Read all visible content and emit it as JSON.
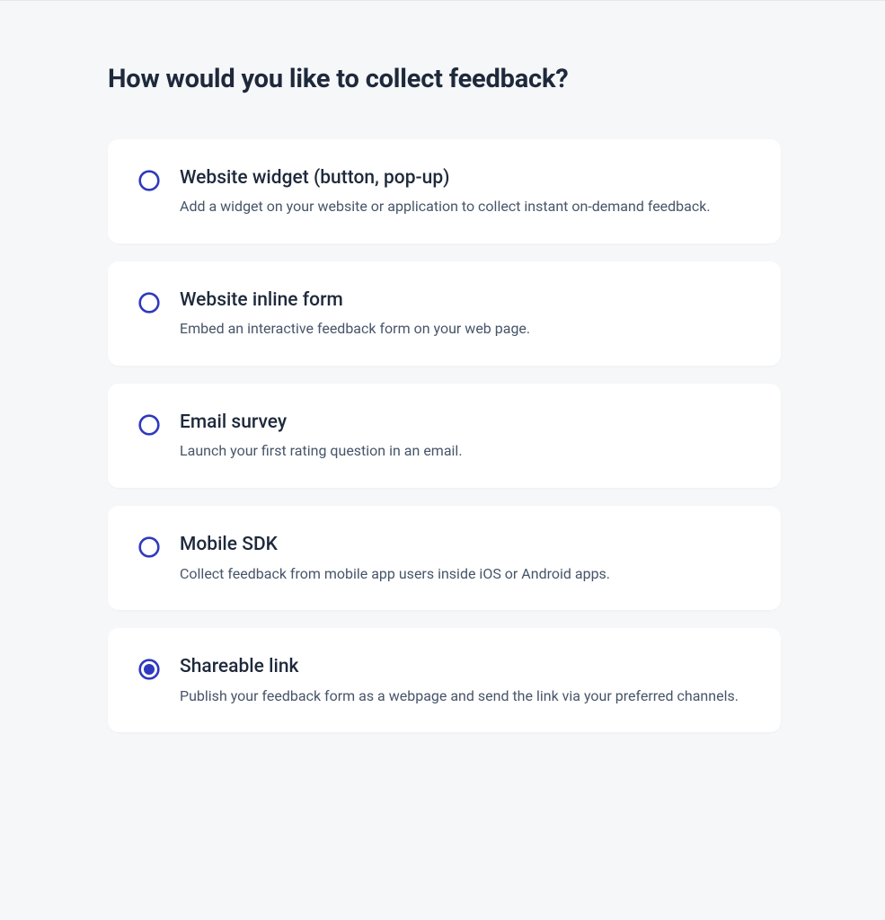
{
  "heading": "How would you like to collect feedback?",
  "options": [
    {
      "title": "Website widget (button, pop-up)",
      "description": "Add a widget on your website or application to collect instant on-demand feedback.",
      "selected": false
    },
    {
      "title": "Website inline form",
      "description": "Embed an interactive feedback form on your web page.",
      "selected": false
    },
    {
      "title": "Email survey",
      "description": "Launch your first rating question in an email.",
      "selected": false
    },
    {
      "title": "Mobile SDK",
      "description": "Collect feedback from mobile app users inside iOS or Android apps.",
      "selected": false
    },
    {
      "title": "Shareable link",
      "description": "Publish your feedback form as a webpage and send the link via your preferred channels.",
      "selected": true
    }
  ],
  "colors": {
    "radio_border": "#2f39bf",
    "radio_fill": "#2f39bf"
  }
}
